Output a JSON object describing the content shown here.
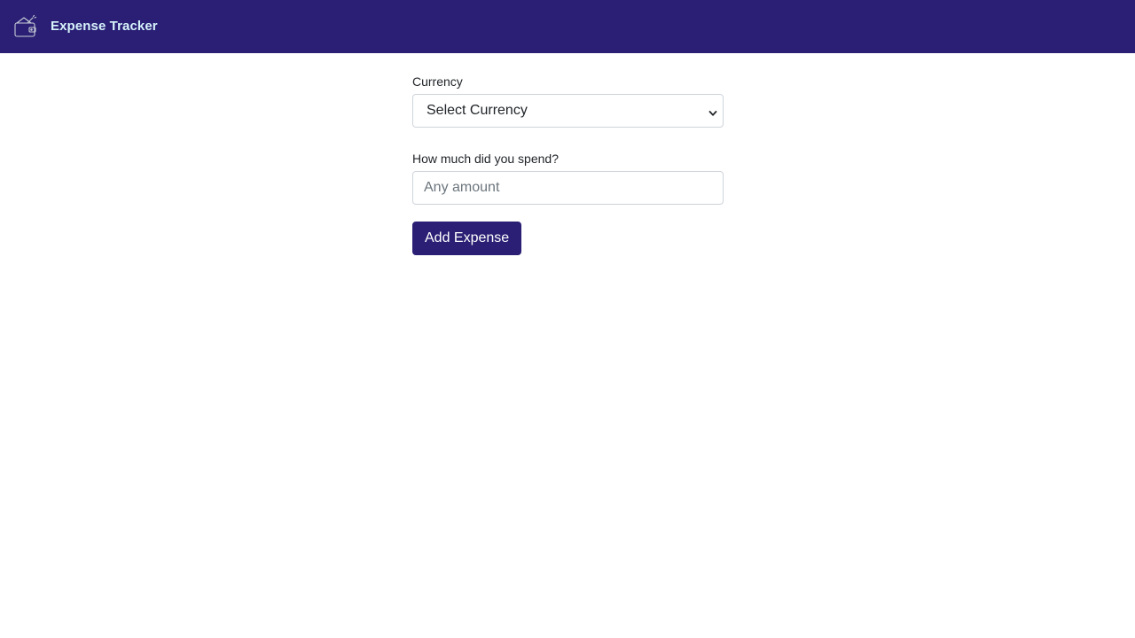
{
  "header": {
    "title": "Expense Tracker",
    "logo_icon": "wallet-icon",
    "background_color": "#2a1f74",
    "title_color": "#d7f3fb"
  },
  "form": {
    "currency": {
      "label": "Currency",
      "selected": "Select Currency",
      "icon": "chevron-down-icon"
    },
    "amount": {
      "label": "How much did you spend?",
      "placeholder": "Any amount",
      "value": ""
    },
    "submit_label": "Add Expense",
    "accent_color": "#2a1f74"
  }
}
